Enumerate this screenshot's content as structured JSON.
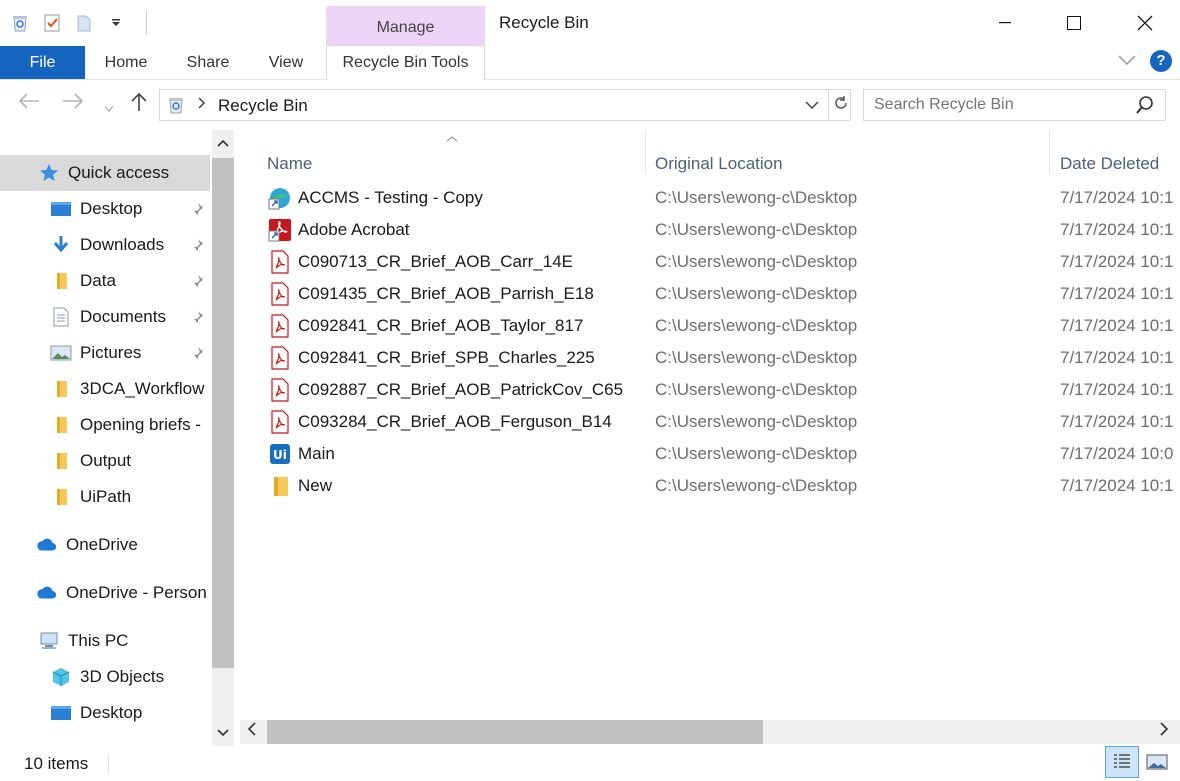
{
  "window": {
    "title": "Recycle Bin"
  },
  "ribbon": {
    "context_group": "Manage",
    "tabs": [
      "File",
      "Home",
      "Share",
      "View",
      "Recycle Bin Tools"
    ]
  },
  "address": {
    "breadcrumb": "Recycle Bin",
    "search_placeholder": "Search Recycle Bin"
  },
  "sidebar": {
    "items": [
      {
        "label": "Quick access",
        "icon": "star-icon",
        "pinned": false,
        "selected": true
      },
      {
        "label": "Desktop",
        "icon": "desktop-folder-icon",
        "pinned": true
      },
      {
        "label": "Downloads",
        "icon": "downloads-icon",
        "pinned": true
      },
      {
        "label": "Data",
        "icon": "folder-icon",
        "pinned": true
      },
      {
        "label": "Documents",
        "icon": "documents-icon",
        "pinned": true
      },
      {
        "label": "Pictures",
        "icon": "pictures-icon",
        "pinned": true
      },
      {
        "label": "3DCA_Workflow",
        "icon": "folder-icon",
        "pinned": false
      },
      {
        "label": "Opening briefs -",
        "icon": "folder-icon",
        "pinned": false
      },
      {
        "label": "Output",
        "icon": "folder-icon",
        "pinned": false
      },
      {
        "label": "UiPath",
        "icon": "folder-icon",
        "pinned": false
      },
      {
        "label": "OneDrive",
        "icon": "cloud-icon",
        "pinned": false
      },
      {
        "label": "OneDrive - Person",
        "icon": "cloud-icon",
        "pinned": false
      },
      {
        "label": "This PC",
        "icon": "computer-icon",
        "pinned": false
      },
      {
        "label": "3D Objects",
        "icon": "cube-icon",
        "pinned": false
      },
      {
        "label": "Desktop",
        "icon": "desktop-folder-icon",
        "pinned": false
      }
    ]
  },
  "columns": {
    "name": "Name",
    "location": "Original Location",
    "date": "Date Deleted"
  },
  "files": [
    {
      "name": "ACCMS - Testing - Copy",
      "icon": "edge-shortcut-icon",
      "location": "C:\\Users\\ewong-c\\Desktop",
      "date": "7/17/2024 10:1"
    },
    {
      "name": "Adobe Acrobat",
      "icon": "acrobat-shortcut-icon",
      "location": "C:\\Users\\ewong-c\\Desktop",
      "date": "7/17/2024 10:1"
    },
    {
      "name": "C090713_CR_Brief_AOB_Carr_14E",
      "icon": "pdf-icon",
      "location": "C:\\Users\\ewong-c\\Desktop",
      "date": "7/17/2024 10:1"
    },
    {
      "name": "C091435_CR_Brief_AOB_Parrish_E18",
      "icon": "pdf-icon",
      "location": "C:\\Users\\ewong-c\\Desktop",
      "date": "7/17/2024 10:1"
    },
    {
      "name": "C092841_CR_Brief_AOB_Taylor_817",
      "icon": "pdf-icon",
      "location": "C:\\Users\\ewong-c\\Desktop",
      "date": "7/17/2024 10:1"
    },
    {
      "name": "C092841_CR_Brief_SPB_Charles_225",
      "icon": "pdf-icon",
      "location": "C:\\Users\\ewong-c\\Desktop",
      "date": "7/17/2024 10:1"
    },
    {
      "name": "C092887_CR_Brief_AOB_PatrickCov_C65",
      "icon": "pdf-icon",
      "location": "C:\\Users\\ewong-c\\Desktop",
      "date": "7/17/2024 10:1"
    },
    {
      "name": "C093284_CR_Brief_AOB_Ferguson_B14",
      "icon": "pdf-icon",
      "location": "C:\\Users\\ewong-c\\Desktop",
      "date": "7/17/2024 10:1"
    },
    {
      "name": "Main",
      "icon": "uipath-icon",
      "location": "C:\\Users\\ewong-c\\Desktop",
      "date": "7/17/2024 10:0"
    },
    {
      "name": "New",
      "icon": "folder-icon",
      "location": "C:\\Users\\ewong-c\\Desktop",
      "date": "7/17/2024 10:1"
    }
  ],
  "status": {
    "item_count": "10 items"
  },
  "colors": {
    "file_tab": "#1565c0",
    "manage_tab": "#edd3f5",
    "selected_nav": "#d9d9d9",
    "location_text": "#6d6d6d"
  }
}
